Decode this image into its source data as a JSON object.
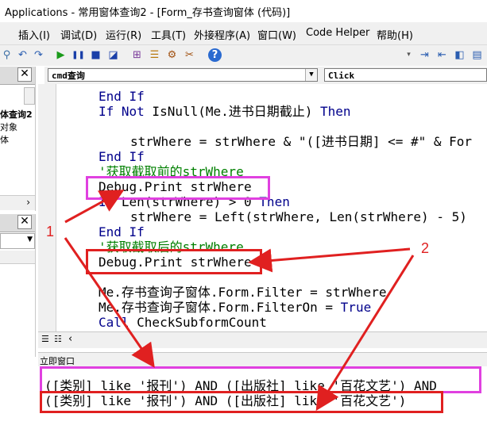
{
  "window": {
    "title": "Applications - 常用窗体查询2 - [Form_存书查询窗体 (代码)]"
  },
  "menu": {
    "items": [
      "插入(I)",
      "调试(D)",
      "运行(R)",
      "工具(T)",
      "外接程序(A)",
      "窗口(W)",
      "Code Helper",
      "帮助(H)"
    ]
  },
  "left_panel": {
    "project_items": [
      "体查询2",
      "对象",
      "体"
    ]
  },
  "code_window": {
    "object_combo": "cmd查询",
    "proc_combo": "Click",
    "lines": {
      "l1": "End If",
      "l2_kw": "If Not",
      "l2_rest": " IsNull(Me.进书日期截止) ",
      "l2_kw2": "Then",
      "l3": "strWhere = strWhere & \"([进书日期] <= #\" & For",
      "l4": "End If",
      "l5": "'获取截取前的strWhere",
      "l6": "Debug.Print strWhere",
      "l7_kw": "If",
      "l7_rest": " Len(strWhere) > 0 ",
      "l7_kw2": "Then",
      "l8": "strWhere = Left(strWhere, Len(strWhere) - 5)",
      "l9": "End If",
      "l10": "'获取截取后的strWhere",
      "l11": "Debug.Print strWhere",
      "l12": "Me.存书查询子窗体.Form.Filter = strWhere",
      "l13_a": "Me.存书查询子窗体.Form.FilterOn = ",
      "l13_kw": "True",
      "l14_kw": "Call",
      "l14_rest": " CheckSubformCount"
    }
  },
  "immediate_window": {
    "title": "立即窗口",
    "line1": "([类别] like '报刊') AND ([出版社] like '百花文艺') AND",
    "line2": "([类别] like '报刊') AND ([出版社] like '百花文艺')"
  },
  "annotations": {
    "label_1": "1",
    "label_2": "2",
    "box_magenta": "#e040e0",
    "box_red": "#e02020"
  }
}
